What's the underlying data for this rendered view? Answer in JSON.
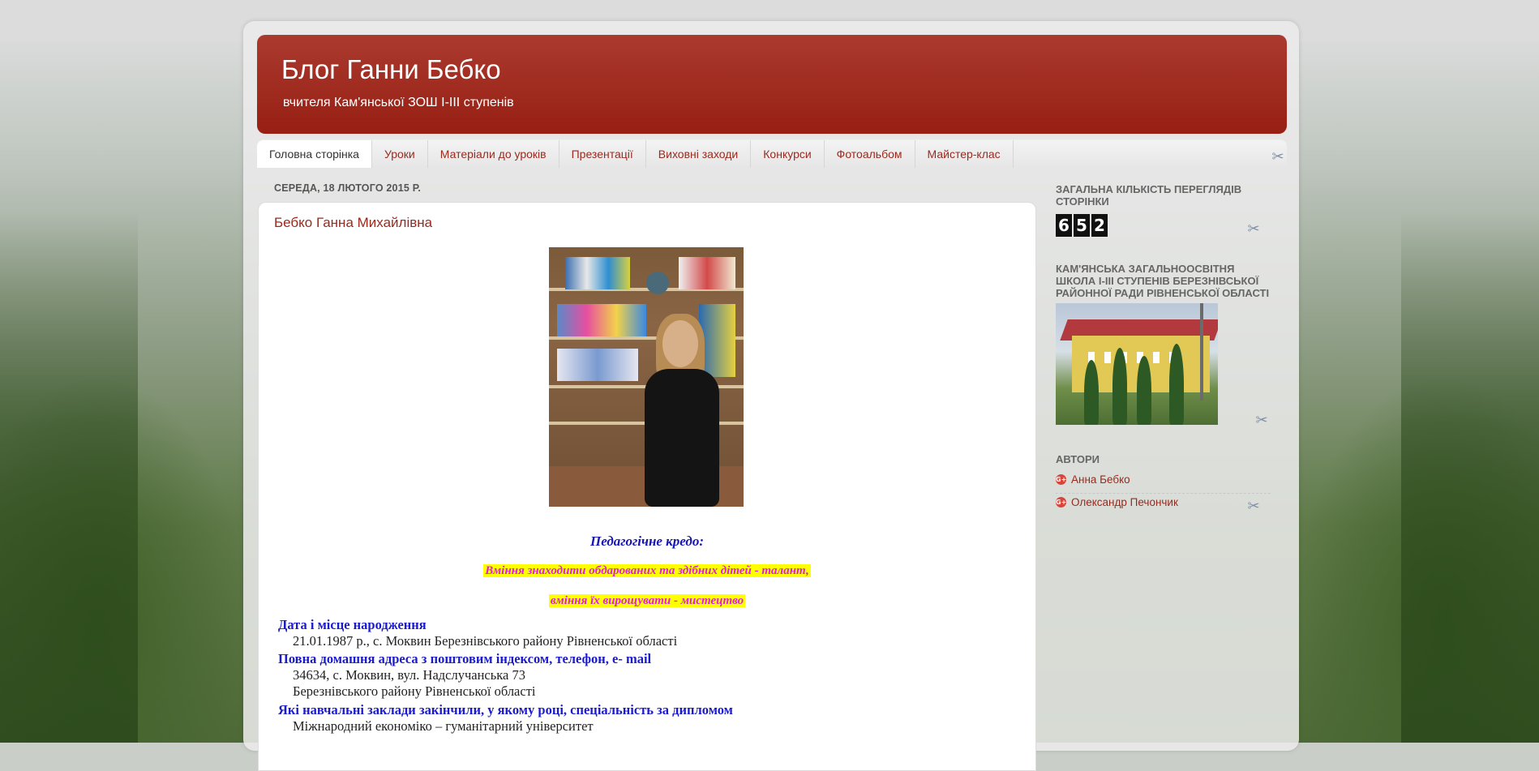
{
  "blog": {
    "title": "Блог Ганни Бебко",
    "description": "вчителя Кам'янської ЗОШ I-III ступенів"
  },
  "tabs": [
    {
      "label": "Головна сторінка"
    },
    {
      "label": "Уроки"
    },
    {
      "label": "Матеріали до уроків"
    },
    {
      "label": "Презентації"
    },
    {
      "label": "Виховні заходи"
    },
    {
      "label": "Конкурси"
    },
    {
      "label": "Фотоальбом"
    },
    {
      "label": "Майстер-клас"
    }
  ],
  "post": {
    "date": "СЕРЕДА, 18 ЛЮТОГО 2015 Р.",
    "title": "Бебко Ганна Михайлівна",
    "credo_title": "Педагогічне кредо:",
    "credo_line_1": "Вміння знаходити обдарованих та здібних дітей - талант,",
    "credo_line_2": "вміння їх вирощувати - мистецтво",
    "sections": [
      {
        "label": "Дата і місце народження",
        "values": [
          "21.01.1987 р., с. Моквин Березнівського району Рівненської області"
        ]
      },
      {
        "label": "Повна домашня адреса з поштовим індексом, телефон, е- mail",
        "values": [
          "34634, с. Моквин, вул. Надслучанська 73",
          "Березнівського району Рівненської області"
        ]
      },
      {
        "label": "Які навчальні заклади закінчили, у якому році, спеціальність за дипломом",
        "values": [
          "Міжнародний економіко – гуманітарний університет"
        ]
      }
    ]
  },
  "sidebar": {
    "views_title": "ЗАГАЛЬНА КІЛЬКІСТЬ ПЕРЕГЛЯДІВ СТОРІНКИ",
    "views_digits": [
      "6",
      "5",
      "2"
    ],
    "school_title": "КАМ'ЯНСЬКА ЗАГАЛЬНООСВІТНЯ ШКОЛА І-ІІІ СТУПЕНІВ БЕРЕЗНІВСЬКОЇ РАЙОННОЇ РАДИ РІВНЕНСЬКОЇ ОБЛАСТІ",
    "authors_title": "АВТОРИ",
    "authors": [
      "Анна Бебко",
      "Олександр Печончик"
    ],
    "gplus_glyph": "G+"
  },
  "icons": {
    "edit": "✂"
  },
  "colors": {
    "header": "#9b2a1e",
    "link": "#9a2a1e",
    "credo_label": "#1414b8",
    "highlight": "#ffff00",
    "credo_text": "#e01ee0"
  }
}
